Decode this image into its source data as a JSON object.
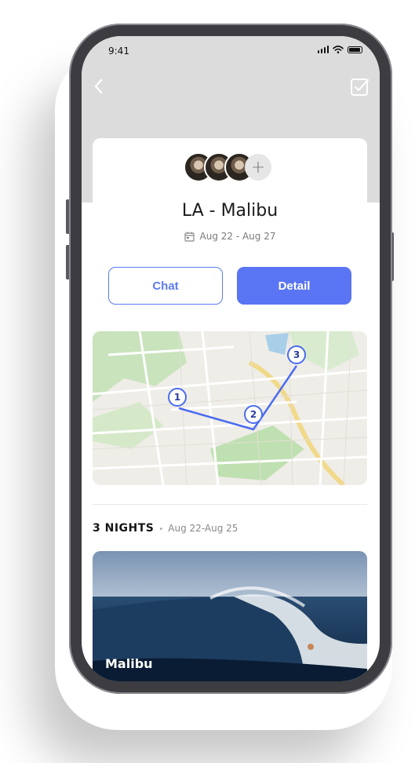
{
  "status_bar": {
    "time": "9:41"
  },
  "header": {
    "back_icon": "chevron-left-icon",
    "action_icon": "checkbox-edit-icon"
  },
  "trip": {
    "title": "LA - Malibu",
    "dates": "Aug 22 - Aug 27",
    "add_member_label": "+",
    "buttons": {
      "chat": "Chat",
      "detail": "Detail"
    }
  },
  "map": {
    "stops": [
      "1",
      "2",
      "3"
    ],
    "route_color": "#4a6cf0"
  },
  "nights": {
    "label": "3 NIGHTS",
    "separator": "•",
    "dates": "Aug 22-Aug 25"
  },
  "photo_card": {
    "title": "Malibu"
  },
  "colors": {
    "accent": "#5a75f3",
    "header_bg": "#dcdcdc"
  }
}
